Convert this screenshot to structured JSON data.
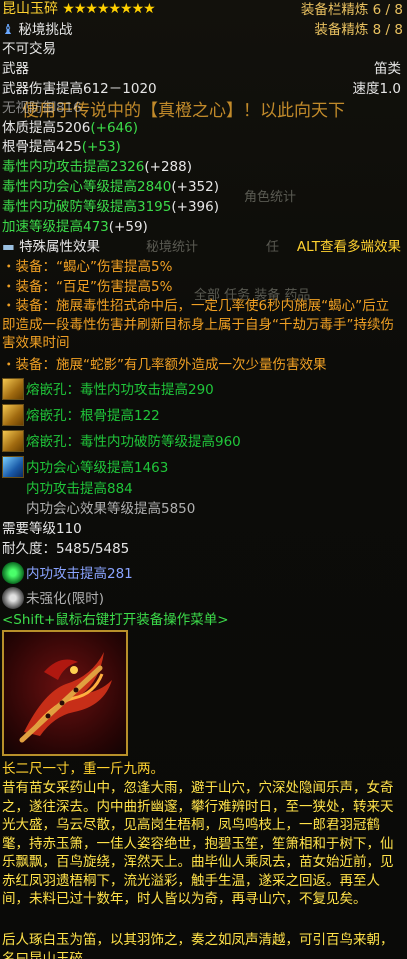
{
  "item": {
    "name": "昆山玉碎",
    "stars": "★★★★★★★★",
    "refine_slot": "装备栏精炼 6 / 8",
    "refine_equip": "装备精炼 8 / 8",
    "source": "秘境挑战",
    "trade": "不可交易",
    "category": "武器",
    "weapon_type": "笛类",
    "damage": "武器伤害提高612－1020",
    "speed": "速度1.0",
    "defense_partial": "无视防御816",
    "attributes": [
      {
        "label": "体质提高5206",
        "bonus": "(+646)"
      },
      {
        "label": "根骨提高425",
        "bonus": "(+53)"
      },
      {
        "label": "毒性内功攻击提高2326",
        "bonus": "(+288)"
      },
      {
        "label": "毒性内功会心等级提高2840",
        "bonus": "(+352)"
      },
      {
        "label": "毒性内功破防等级提高3195",
        "bonus": "(+396)"
      },
      {
        "label": "加速等级提高473",
        "bonus": "(+59)"
      }
    ],
    "special_header": "特殊属性效果",
    "alt_hint": "ALT查看多端效果",
    "effects": [
      "・装备：“蝎心”伤害提高5%",
      "・装备：“百足”伤害提高5%",
      "・装备：施展毒性招式命中后，一定几率使6秒内施展“蝎心”后立即造成一段毒性伤害并刷新目标身上属于自身“千劫万毒手”持续伤害效果时间",
      "・装备：施展“蛇影”有几率额外造成一次少量伤害效果"
    ],
    "sockets": [
      "熔嵌孔：毒性内功攻击提高290",
      "熔嵌孔：根骨提高122",
      "熔嵌孔：毒性内功破防等级提高960"
    ],
    "enchant": [
      "内功会心等级提高1463",
      "内功攻击提高884",
      "内功会心效果等级提高5850"
    ],
    "req_level": "需要等级110",
    "durability": "耐久度：5485/5485",
    "extra_enchant": "内功攻击提高281",
    "strengthen": "未强化(限时)",
    "menu_hint": "<Shift+鼠标右键打开装备操作菜单>",
    "size_line": "长二尺一寸，重一斤九两。",
    "lore": "昔有苗女采药山中，忽逢大雨，避于山穴，穴深处隐闻乐声，女奇之，遂往深去。内中曲折幽邃，攀行难辨时日，至一狭处，转来天光大盛，乌云尽散，见高岗生梧桐，凤鸟鸣枝上，一郎君羽冠鹤氅，持赤玉箫，一佳人姿容绝世，抱碧玉笙，笙箫相和于树下，仙乐飘飘，百鸟旋绕，浑然天上。曲毕仙人乘凤去，苗女始近前，见赤红凤羽遗梧桐下，流光溢彩，触手生温，遂采之回返。再至人间，未料已过十数年，时人皆以为奇，再寻山穴，不复见矣。",
    "lore2": "后人琢白玉为笛，以其羽饰之，奏之如凤声清越，可引百鸟来朝，名曰昆山玉碎。"
  },
  "background": {
    "banner": "便用于传说中的【真橙之心】！以此向天下",
    "stats_tab": "角色统计",
    "secret_tab": "秘境统计",
    "tabs_row": "全部   任务   装备   药品",
    "ren": "任"
  },
  "colors": {
    "name": "#ffd230",
    "attribute": "#3cdc4a",
    "effect": "#f0a024",
    "lore": "#ffe24a",
    "refine": "#e8c060"
  }
}
